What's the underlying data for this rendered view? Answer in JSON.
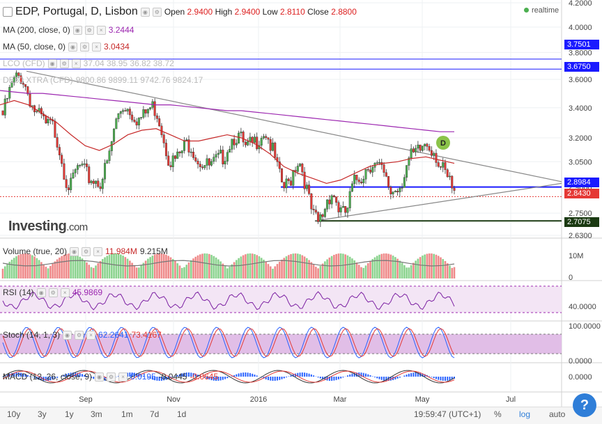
{
  "header": {
    "symbol": "EDP, Portugal, D, Lisbon",
    "open_label": "Open",
    "open": "2.9400",
    "high_label": "High",
    "high": "2.9400",
    "low_label": "Low",
    "low": "2.8110",
    "close_label": "Close",
    "close": "2.8800",
    "realtime": "realtime"
  },
  "legend": {
    "ma200": {
      "label": "MA (200, close, 0)",
      "value": "3.2444",
      "color": "#9c27b0"
    },
    "ma50": {
      "label": "MA (50, close, 0)",
      "value": "3.0434",
      "color": "#c62828"
    },
    "lco": {
      "label": "LCO (CFD)",
      "values": "37.04  38.95  36.82  38.72"
    },
    "dax": {
      "label": "DE30 XTRA (CFD)",
      "values": "9800.86  9899.11  9742.76  9824.17"
    },
    "volume": {
      "label": "Volume (true, 20)",
      "v1": "11.984M",
      "v2": "9.215M"
    },
    "rsi": {
      "label": "RSI (14)",
      "value": "45.9869"
    },
    "stoch": {
      "label": "Stoch (14, 1, 3)",
      "v1": "62.2641",
      "v2": "73.4167"
    },
    "macd": {
      "label": "MACD (12, 26, close, 9)",
      "v1": "0.0195",
      "v2": "-0.0445",
      "v3": "-0.0645"
    }
  },
  "price_tags": {
    "t1": {
      "text": "3.7501",
      "color": "#1a1aff"
    },
    "t2": {
      "text": "3.6750",
      "color": "#1a1aff"
    },
    "t3": {
      "text": "2.8984",
      "color": "#1a1aff"
    },
    "t4": {
      "text": "2.8430",
      "color": "#e53935"
    },
    "t5": {
      "text": "2.7075",
      "color": "#1b3a12"
    }
  },
  "pattern_marker": "D",
  "logo": {
    "brand": "Investing",
    "suffix": ".com"
  },
  "bottom": {
    "timeframes": [
      "10y",
      "3y",
      "1y",
      "3m",
      "1m",
      "7d",
      "1d"
    ],
    "clock": "19:59:47 (UTC+1)",
    "pct": "%",
    "log": "log",
    "auto": "auto",
    "help": "?"
  },
  "chart_data": {
    "type": "candlestick",
    "x_ticks": [
      "Sep",
      "Nov",
      "2016",
      "Mar",
      "May",
      "Jul"
    ],
    "price_axis": [
      "4.2000",
      "4.0000",
      "3.8000",
      "3.6000",
      "3.4000",
      "3.2000",
      "3.0500",
      "2.9000",
      "2.7500",
      "2.6300"
    ],
    "price_range": [
      2.63,
      4.2
    ],
    "closes": [
      3.38,
      3.5,
      3.6,
      3.65,
      3.64,
      3.55,
      3.45,
      3.38,
      3.36,
      3.3,
      3.32,
      3.25,
      3.12,
      2.98,
      2.92,
      3.02,
      3.05,
      3.0,
      2.98,
      2.97,
      2.96,
      3.02,
      3.12,
      3.3,
      3.4,
      3.45,
      3.42,
      3.38,
      3.35,
      3.37,
      3.42,
      3.44,
      3.38,
      3.25,
      3.12,
      3.08,
      3.1,
      3.15,
      3.2,
      3.18,
      3.1,
      3.08,
      3.05,
      3.05,
      3.08,
      3.1,
      3.15,
      3.22,
      3.25,
      3.22,
      3.15,
      3.18,
      3.2,
      3.25,
      3.28,
      3.2,
      3.1,
      2.98,
      2.92,
      2.95,
      3.05,
      3.1,
      3.0,
      2.85,
      2.75,
      2.72,
      2.78,
      2.88,
      2.9,
      2.82,
      2.76,
      2.8,
      2.92,
      2.98,
      3.0,
      3.05,
      3.08,
      3.05,
      3.02,
      2.95,
      2.9,
      2.92,
      2.95,
      3.05,
      3.1,
      3.12,
      3.15,
      3.2,
      3.18,
      3.15,
      3.05,
      3.0,
      2.95,
      2.88
    ],
    "ma200": [
      3.52,
      3.51,
      3.5,
      3.5,
      3.49,
      3.48,
      3.47,
      3.46,
      3.45,
      3.44,
      3.43,
      3.42,
      3.42,
      3.41,
      3.4,
      3.39,
      3.38,
      3.38,
      3.37,
      3.36,
      3.35,
      3.34,
      3.33,
      3.32,
      3.31,
      3.3,
      3.29,
      3.28,
      3.27,
      3.26,
      3.25,
      3.24,
      3.24
    ],
    "ma50": [
      3.42,
      3.45,
      3.42,
      3.36,
      3.3,
      3.22,
      3.15,
      3.12,
      3.16,
      3.22,
      3.25,
      3.26,
      3.22,
      3.18,
      3.18,
      3.2,
      3.22,
      3.2,
      3.16,
      3.1,
      3.02,
      2.98,
      2.95,
      2.92,
      2.94,
      2.98,
      3.02,
      3.04,
      3.05,
      3.07,
      3.08,
      3.06,
      3.04
    ],
    "h_levels": [
      3.7501,
      3.675,
      2.8984,
      2.843,
      2.7075
    ],
    "rsi_range": [
      0,
      100
    ],
    "rsi_ticks": [
      "40.0000"
    ],
    "stoch_ticks": [
      "100.0000",
      "0.0000"
    ],
    "macd_ticks": [
      "0.0000"
    ],
    "volume_ticks": [
      "10M",
      "0"
    ]
  }
}
